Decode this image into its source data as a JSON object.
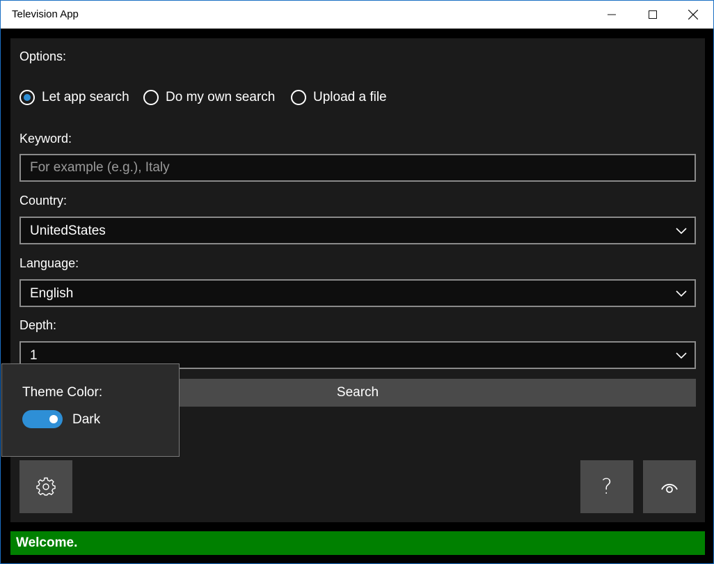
{
  "window": {
    "title": "Television App"
  },
  "options": {
    "label": "Options:",
    "radios": [
      {
        "label": "Let app search",
        "checked": true
      },
      {
        "label": "Do my own search",
        "checked": false
      },
      {
        "label": "Upload a file",
        "checked": false
      }
    ]
  },
  "keyword": {
    "label": "Keyword:",
    "value": "",
    "placeholder": "For example (e.g.), Italy"
  },
  "country": {
    "label": "Country:",
    "selected": "UnitedStates"
  },
  "language": {
    "label": "Language:",
    "selected": "English"
  },
  "depth": {
    "label": "Depth:",
    "selected": "1"
  },
  "search_button": {
    "label": "Search"
  },
  "icons": {
    "settings": "gear-icon",
    "help": "question-icon",
    "view": "eye-icon"
  },
  "help_button": {
    "label": "?"
  },
  "theme_flyout": {
    "title": "Theme Color:",
    "toggle_label": "Dark",
    "toggle_on": true
  },
  "status": {
    "text": "Welcome.",
    "color": "#008000"
  },
  "colors": {
    "accent": "#2e8fd6",
    "background": "#1b1b1b",
    "button": "#4a4a4a"
  }
}
